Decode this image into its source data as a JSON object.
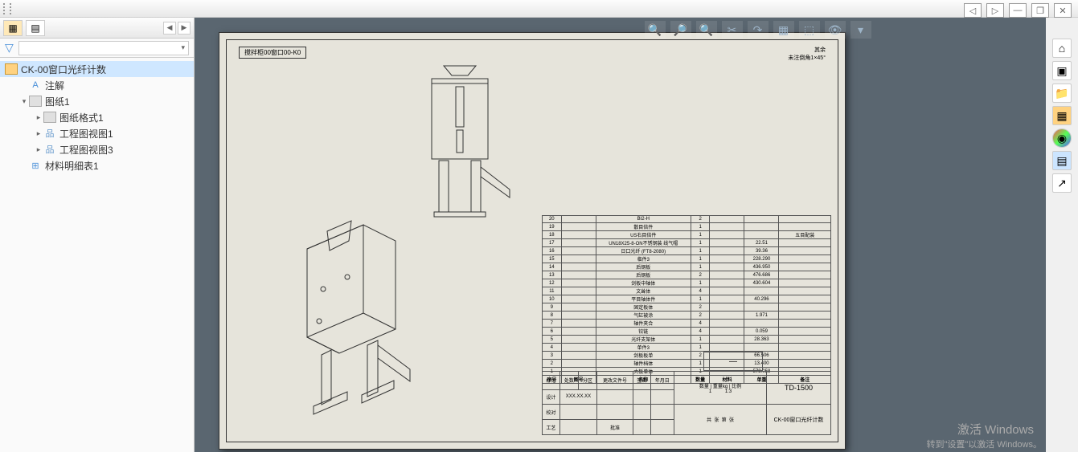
{
  "window": {
    "btn1": "◁",
    "btn2": "▷",
    "btn_min": "—",
    "btn_restore": "❐",
    "btn_close": "✕"
  },
  "right_bar": [
    "⌂",
    "▣",
    "📁",
    "▦",
    "◉",
    "▤",
    "↗"
  ],
  "left_tabs": {
    "tab1": "▦",
    "tab2": "▤"
  },
  "filter": {
    "funnel": "▼",
    "dropdown_arrow": "▾"
  },
  "tree": {
    "root": "CK-00窗口光纤计数",
    "anno": "注解",
    "sheet": "图纸1",
    "fmt": "图纸格式1",
    "view1": "工程图视图1",
    "view3": "工程图视图3",
    "bom": "材料明细表1"
  },
  "view_toolbar": [
    "🔍",
    "🔎",
    "🔍",
    "✂",
    "↷",
    "▦",
    "⬚",
    "👁",
    "▾"
  ],
  "sheet": {
    "title_tag": "搅拌柜00窗口00-K0",
    "note1": "其余",
    "note2": "未注倒角1×45°"
  },
  "bom_header": [
    "序号",
    "图号",
    "名称",
    "数量",
    "材料",
    "单重",
    "备注"
  ],
  "bom": [
    {
      "n": "20",
      "code": "",
      "name": "BI2-H",
      "qty": "2",
      "mat": "",
      "wt": "",
      "rem": ""
    },
    {
      "n": "19",
      "code": "",
      "name": "散目倍件",
      "qty": "1",
      "mat": "",
      "wt": "",
      "rem": ""
    },
    {
      "n": "18",
      "code": "",
      "name": "US右目倍件",
      "qty": "1",
      "mat": "",
      "wt": "",
      "rem": "五目配装"
    },
    {
      "n": "17",
      "code": "",
      "name": "UN18X25-8-ON不锈钢装 线气帽",
      "qty": "1",
      "mat": "",
      "wt": "22.51",
      "rem": ""
    },
    {
      "n": "16",
      "code": "",
      "name": "日口光纤 (FT8-2080)",
      "qty": "1",
      "mat": "",
      "wt": "39.36",
      "rem": ""
    },
    {
      "n": "15",
      "code": "",
      "name": "临件3",
      "qty": "1",
      "mat": "",
      "wt": "228.290",
      "rem": ""
    },
    {
      "n": "14",
      "code": "",
      "name": "后钢板",
      "qty": "1",
      "mat": "",
      "wt": "436.950",
      "rem": ""
    },
    {
      "n": "13",
      "code": "",
      "name": "后钢板",
      "qty": "2",
      "mat": "",
      "wt": "476.686",
      "rem": ""
    },
    {
      "n": "12",
      "code": "",
      "name": "剑板中轴体",
      "qty": "1",
      "mat": "",
      "wt": "430.604",
      "rem": ""
    },
    {
      "n": "11",
      "code": "",
      "name": "文耸体",
      "qty": "4",
      "mat": "",
      "wt": "",
      "rem": ""
    },
    {
      "n": "10",
      "code": "",
      "name": "平目轴体件",
      "qty": "1",
      "mat": "",
      "wt": "40.296",
      "rem": ""
    },
    {
      "n": "9",
      "code": "",
      "name": "固定板体",
      "qty": "2",
      "mat": "",
      "wt": "",
      "rem": ""
    },
    {
      "n": "8",
      "code": "",
      "name": "气缸被涂",
      "qty": "2",
      "mat": "",
      "wt": "1.971",
      "rem": ""
    },
    {
      "n": "7",
      "code": "",
      "name": "轴件夹合",
      "qty": "4",
      "mat": "",
      "wt": "",
      "rem": ""
    },
    {
      "n": "6",
      "code": "",
      "name": "铰链",
      "qty": "4",
      "mat": "",
      "wt": "0.059",
      "rem": ""
    },
    {
      "n": "5",
      "code": "",
      "name": "光纤支架体",
      "qty": "1",
      "mat": "",
      "wt": "28.363",
      "rem": ""
    },
    {
      "n": "4",
      "code": "",
      "name": "单件3",
      "qty": "1",
      "mat": "",
      "wt": "",
      "rem": ""
    },
    {
      "n": "3",
      "code": "",
      "name": "剑板板单",
      "qty": "2",
      "mat": "",
      "wt": "66.506",
      "rem": ""
    },
    {
      "n": "2",
      "code": "",
      "name": "轴件档体",
      "qty": "1",
      "mat": "",
      "wt": "13.400",
      "rem": ""
    },
    {
      "n": "1",
      "code": "",
      "name": "大板单体",
      "qty": "1",
      "mat": "",
      "wt": "573.058",
      "rem": ""
    }
  ],
  "title_block": {
    "row1": [
      "标记",
      "处数",
      "分区",
      "更改文件号",
      "签名",
      "年月日"
    ],
    "row2_l": "设计",
    "row2_v": "XXX.XX.XX",
    "row3_l": "校对",
    "row4_l": "工艺",
    "row4_v": "批准",
    "qty_h": "数量",
    "wt_h": "重量kg",
    "scale_h": "比例",
    "qty_v": "1",
    "scale_v": "1:3",
    "bot": [
      "共",
      "张",
      "第",
      "张"
    ],
    "model": "TD-1500",
    "name": "CK-00窗口光纤计数",
    "dash": "—"
  },
  "watermark": {
    "line1": "激活 Windows",
    "line2": "转到\"设置\"以激活 Windows。"
  }
}
